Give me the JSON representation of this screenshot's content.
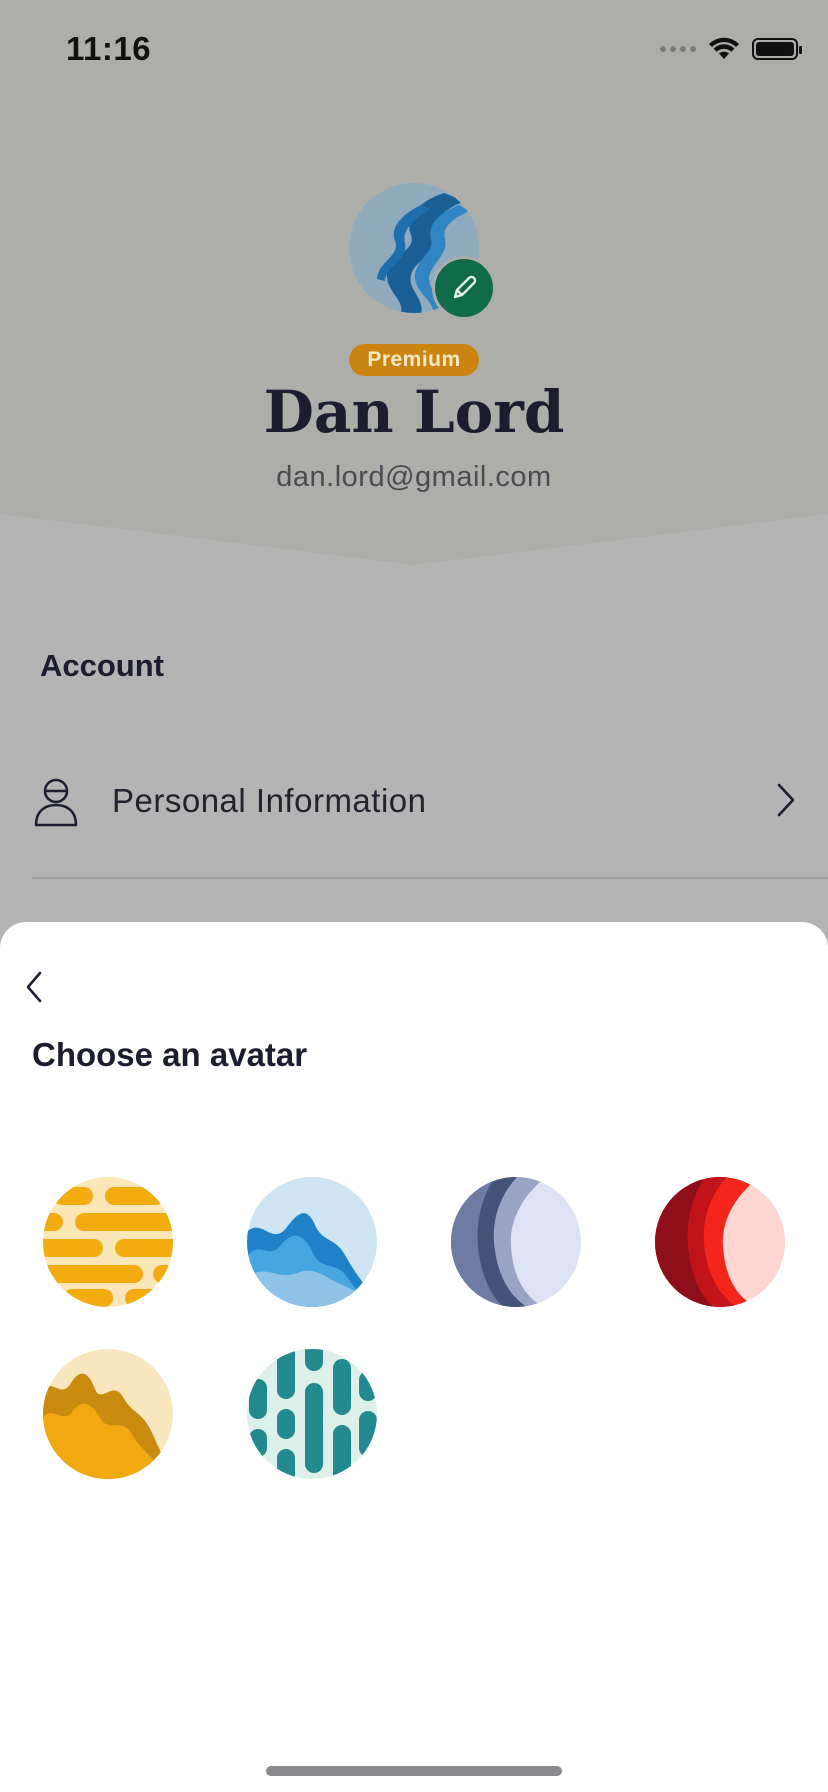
{
  "status_bar": {
    "time": "11:16"
  },
  "profile": {
    "badge": "Premium",
    "name": "Dan Lord",
    "email": "dan.lord@gmail.com",
    "avatar_icon": "river-avatar",
    "edit_icon": "pencil-icon"
  },
  "account": {
    "title": "Account",
    "items": [
      {
        "label": "Personal Information",
        "icon": "person-icon"
      }
    ]
  },
  "avatar_sheet": {
    "title": "Choose an avatar",
    "back_icon": "chevron-left-icon",
    "options": [
      {
        "name": "yellow-stripes",
        "colors": [
          "#f3ac0f",
          "#fbe6b8"
        ]
      },
      {
        "name": "blue-waves",
        "colors": [
          "#1f82c8",
          "#cfe5f4"
        ]
      },
      {
        "name": "slate-crescent",
        "colors": [
          "#45527a",
          "#dde3f5"
        ]
      },
      {
        "name": "red-crescent",
        "colors": [
          "#c2131b",
          "#ffd6d2"
        ]
      },
      {
        "name": "amber-mountains",
        "colors": [
          "#f1a90f",
          "#f8e6bf"
        ]
      },
      {
        "name": "teal-dashes",
        "colors": [
          "#228a8f",
          "#dcefe9"
        ]
      }
    ]
  },
  "colors": {
    "accent_green": "#0f6b4a",
    "premium": "#c9850f"
  }
}
